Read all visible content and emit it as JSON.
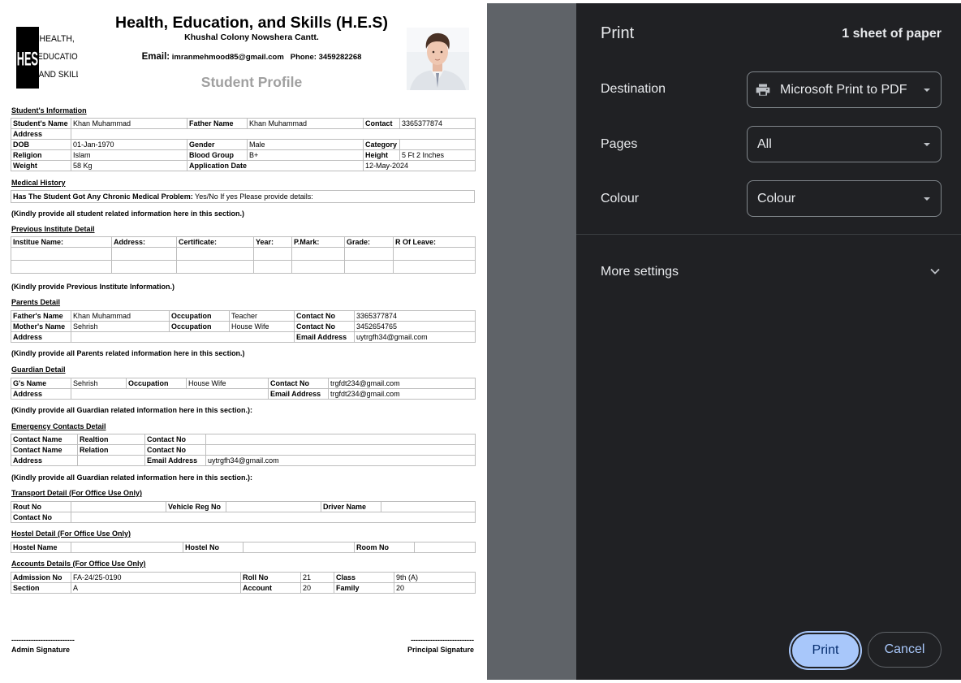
{
  "header": {
    "school_name": "Health, Education, and Skills (H.E.S)",
    "address": "Khushal Colony Nowshera Cantt.",
    "email_label": "Email:",
    "email": "imranmehmood85@gmail.com",
    "phone_label": "Phone:",
    "phone": "3459282268",
    "profile_title": "Student Profile",
    "logo_text": {
      "initials": "HES",
      "line1": "HEALTH,",
      "line2": "EDUCATION,",
      "line3": "AND SKILLS"
    }
  },
  "student": {
    "title": "Student's Information",
    "name_label": "Student's Name",
    "name": "Khan Muhammad",
    "father_label": "Father Name",
    "father": "Khan Muhammad",
    "contact_label": "Contact",
    "contact": "3365377874",
    "address_label": "Address",
    "address": "",
    "dob_label": "DOB",
    "dob": "01-Jan-1970",
    "gender_label": "Gender",
    "gender": "Male",
    "category_label": "Category",
    "category": "",
    "religion_label": "Religion",
    "religion": "Islam",
    "blood_label": "Blood Group",
    "blood": "B+",
    "height_label": "Height",
    "height": "5 Ft 2 Inches",
    "weight_label": "Weight",
    "weight": "58 Kg",
    "appdate_label": "Application Date",
    "appdate": "12-May-2024"
  },
  "medical": {
    "title": "Medical History",
    "q": "Has The Student Got Any Chronic Medical Problem:",
    "a": "Yes/No If yes Please provide details:",
    "note": "(Kindly provide all student related information here in this section.)"
  },
  "previous": {
    "title": "Previous Institute Detail",
    "headers": [
      "Institue Name:",
      "Address:",
      "Certificate:",
      "Year:",
      "P.Mark:",
      "Grade:",
      "R Of Leave:"
    ],
    "note": "(Kindly provide Previous Institute Information.)"
  },
  "parents": {
    "title": "Parents Detail",
    "father_label": "Father's Name",
    "father": "Khan Muhammad",
    "f_occ_label": "Occupation",
    "f_occ": "Teacher",
    "f_contact_label": "Contact No",
    "f_contact": "3365377874",
    "mother_label": "Mother's Name",
    "mother": "Sehrish",
    "m_occ_label": "Occupation",
    "m_occ": "House Wife",
    "m_contact_label": "Contact No",
    "m_contact": "3452654765",
    "address_label": "Address",
    "address": "",
    "email_label": "Email Address",
    "email": "uytrgfh34@gmail.com",
    "note": "(Kindly provide all Parents related information here in this section.)"
  },
  "guardian": {
    "title": "Guardian Detail",
    "name_label": "G's Name",
    "name": "Sehrish",
    "occ_label": "Occupation",
    "occ": "House Wife",
    "contact_label": "Contact No",
    "contact": "trgfdt234@gmail.com",
    "address_label": "Address",
    "address": "",
    "email_label": "Email Address",
    "email": "trgfdt234@gmail.com",
    "note": "(Kindly provide all Guardian related information here in this section.):"
  },
  "emergency": {
    "title": "Emergency Contacts Detail",
    "c1_label": "Contact Name",
    "r1_label": "Realtion",
    "n1_label": "Contact No",
    "c2_label": "Contact Name",
    "r2_label": "Relation",
    "n2_label": "Contact No",
    "address_label": "Address",
    "email_label": "Email Address",
    "email": "uytrgfh34@gmail.com",
    "note": "(Kindly provide all Guardian related information here in this section.):"
  },
  "transport": {
    "title": "Transport Detail (For Office Use Only)",
    "route_label": "Rout No",
    "vehicle_label": "Vehicle Reg No",
    "driver_label": "Driver Name",
    "contact_label": "Contact No"
  },
  "hostel": {
    "title": "Hostel Detail (For Office Use Only)",
    "name_label": "Hostel Name",
    "no_label": "Hostel No",
    "room_label": "Room No"
  },
  "accounts": {
    "title": "Accounts Details (For Office Use Only)",
    "adm_label": "Admission No",
    "adm": "FA-24/25-0190",
    "roll_label": "Roll No",
    "roll": "21",
    "class_label": "Class",
    "class": "9th (A)",
    "section_label": "Section",
    "section": "A",
    "account_label": "Account",
    "account": "20",
    "family_label": "Family",
    "family": "20"
  },
  "signatures": {
    "dashes": "--------------------------",
    "admin": "Admin Signature",
    "principal": "Principal Signature"
  },
  "print_dialog": {
    "title": "Print",
    "sheets": "1 sheet of paper",
    "destination_label": "Destination",
    "destination_value": "Microsoft Print to PDF",
    "pages_label": "Pages",
    "pages_value": "All",
    "colour_label": "Colour",
    "colour_value": "Colour",
    "more_settings": "More settings",
    "print_button": "Print",
    "cancel_button": "Cancel",
    "accent_color": "#a8c7fa",
    "panel_color": "#202124"
  }
}
